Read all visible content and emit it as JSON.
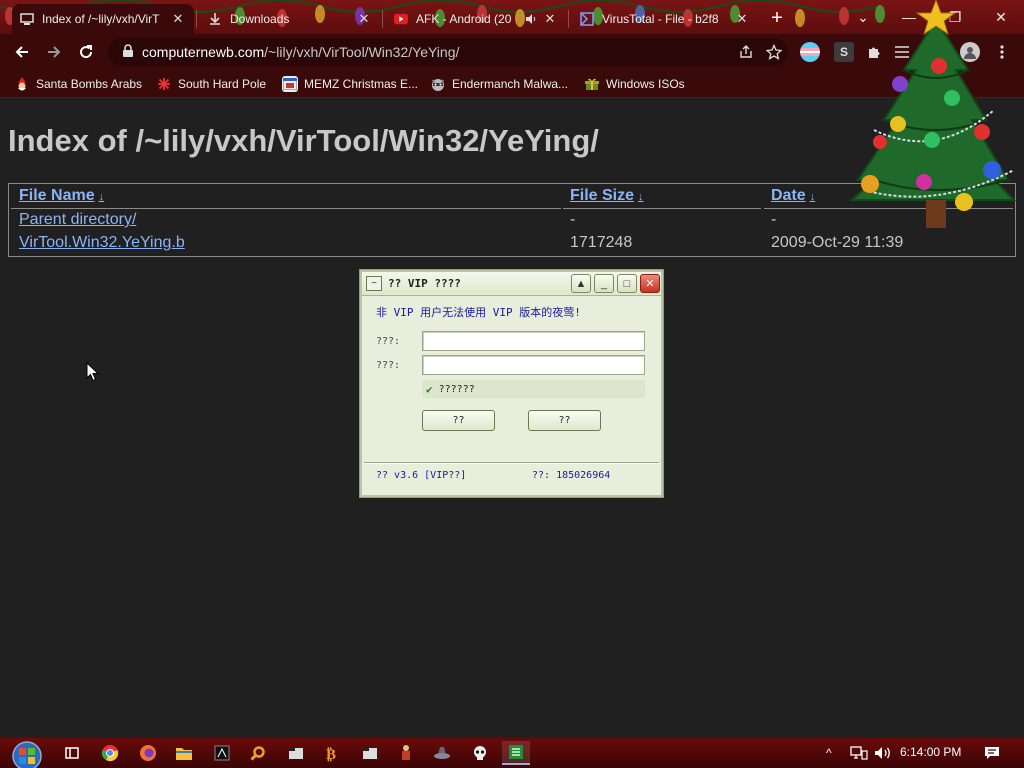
{
  "browser": {
    "tabs": [
      {
        "title": "Index of /~lily/vxh/VirT",
        "active": true,
        "favicon": "monitor-icon"
      },
      {
        "title": "Downloads",
        "active": false,
        "favicon": "download-icon"
      },
      {
        "title": "AFK - Android (20",
        "active": false,
        "favicon": "youtube-icon",
        "audio": true
      },
      {
        "title": "VirusTotal - File - b2f8",
        "active": false,
        "favicon": "virustotal-icon"
      }
    ],
    "close_glyph": "✕",
    "new_tab_glyph": "+",
    "window_controls": {
      "dropdown": "⌄",
      "minimize": "—",
      "maximize": "❐",
      "close": "✕"
    },
    "url_host": "computernewb.com",
    "url_path": "/~lily/vxh/VirTool/Win32/YeYing/",
    "bookmarks": [
      {
        "label": "Santa Bombs Arabs",
        "icon": "santa-icon"
      },
      {
        "label": "South Hard Pole",
        "icon": "snowflake-icon"
      },
      {
        "label": "MEMZ Christmas E...",
        "icon": "window-icon"
      },
      {
        "label": "Endermanch Malwa...",
        "icon": "raccoon-icon"
      },
      {
        "label": "Windows ISOs",
        "icon": "gift-icon"
      }
    ],
    "profile_badge": "S"
  },
  "page": {
    "heading": "Index of /~lily/vxh/VirTool/Win32/YeYing/",
    "columns": {
      "name": "File Name",
      "size": "File Size",
      "date": "Date",
      "sort_arrow": "↓"
    },
    "rows": [
      {
        "name": "Parent directory/",
        "size": "-",
        "date": "-"
      },
      {
        "name": "VirTool.Win32.YeYing.b",
        "size": "1717248",
        "date": "2009-Oct-29 11:39"
      }
    ]
  },
  "dialog": {
    "title": "?? VIP ????",
    "sysmenu_glyph": "−",
    "title_buttons": {
      "up": "▲",
      "min": "_",
      "max": "□",
      "close": "✕"
    },
    "message": "非 VIP 用户无法使用 VIP 版本的夜莺!",
    "label1": "???:",
    "label2": "???:",
    "checkbox_mark": "✔",
    "checkbox_label": "??????",
    "button1": "??",
    "button2": "??",
    "status_left": "?? v3.6 [VIP??]",
    "status_right": "??: 185026964"
  },
  "taskbar": {
    "apps": [
      "task-view-icon",
      "chrome-icon",
      "firefox-icon",
      "file-explorer-icon",
      "app-icon",
      "search-app-icon",
      "folder-app-icon",
      "bitcoin-app-icon",
      "folder-app2-icon",
      "figure-app-icon",
      "hat-app-icon",
      "skull-app-icon",
      "green-app-icon"
    ],
    "clock": "6:14:00 PM",
    "tray_chevron": "^",
    "notif_glyph": "🗨"
  },
  "colors": {
    "tabstrip": "#6a1010",
    "page_bg": "#202020",
    "link": "#8ab4f8",
    "text": "#c8c8c8",
    "dialog_bg": "#e8eedc",
    "dialog_message": "#1a1aa0"
  }
}
